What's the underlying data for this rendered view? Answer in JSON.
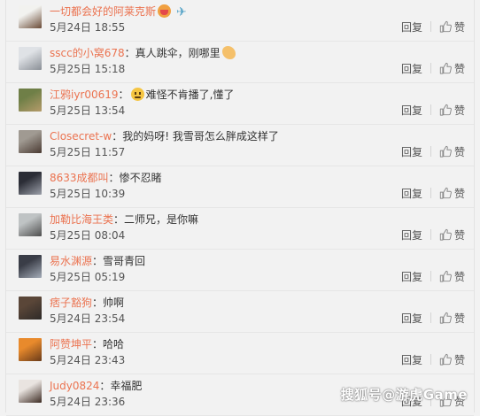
{
  "comments": [
    {
      "user": "一切都会好的阿莱克斯",
      "separator": "",
      "text": "",
      "emoji": [
        "red",
        "plane"
      ],
      "time": "5月24日 18:55",
      "reply": "回复",
      "like": "赞",
      "avatar_colors": [
        "#f2f2ef",
        "#6a4a35"
      ]
    },
    {
      "user": "sscc的小窝678",
      "separator": "：",
      "text": "真人跳伞，刚哪里",
      "emoji": [
        "arm"
      ],
      "time": "5月25日 15:18",
      "reply": "回复",
      "like": "赞",
      "avatar_colors": [
        "#dfe2e6",
        "#8a8f96"
      ]
    },
    {
      "user": "江鸦iyr00619",
      "separator": "：",
      "text": "难怪不肯播了,懂了",
      "emoji_before": true,
      "emoji": [
        "face"
      ],
      "time": "5月25日 13:54",
      "reply": "回复",
      "like": "赞",
      "avatar_colors": [
        "#6f7f47",
        "#b59b6a"
      ]
    },
    {
      "user": "Closecret-w",
      "separator": "：",
      "text": "我的妈呀! 我雪哥怎么胖成这样了",
      "emoji": [],
      "time": "5月25日 11:57",
      "reply": "回复",
      "like": "赞",
      "avatar_colors": [
        "#a09a92",
        "#4a3a32"
      ]
    },
    {
      "user": "8633成都叫",
      "separator": "：",
      "text": "惨不忍睹",
      "emoji": [],
      "time": "5月25日 10:39",
      "reply": "回复",
      "like": "赞",
      "avatar_colors": [
        "#2b2d36",
        "#9ca0aa"
      ]
    },
    {
      "user": "加勒比海王类",
      "separator": "：",
      "text": "二师兄，是你嘛",
      "emoji": [],
      "time": "5月25日 08:04",
      "reply": "回复",
      "like": "赞",
      "avatar_colors": [
        "#bfc3c4",
        "#4e4e4e"
      ]
    },
    {
      "user": "易水渊源",
      "separator": "：",
      "text": "雪哥青回",
      "emoji": [],
      "time": "5月25日 05:19",
      "reply": "回复",
      "like": "赞",
      "avatar_colors": [
        "#3a3d47",
        "#a4acb8"
      ]
    },
    {
      "user": "痞子豁狗",
      "separator": "：",
      "text": "帅啊",
      "emoji": [],
      "time": "5月24日 23:54",
      "reply": "回复",
      "like": "赞",
      "avatar_colors": [
        "#5a4638",
        "#2e2a28"
      ]
    },
    {
      "user": "阿赞坤平",
      "separator": "：",
      "text": "哈哈",
      "emoji": [],
      "time": "5月24日 23:43",
      "reply": "回复",
      "like": "赞",
      "avatar_colors": [
        "#e88a2c",
        "#6a3b1a"
      ]
    },
    {
      "user": "Judy0824",
      "separator": "：",
      "text": "幸福肥",
      "emoji": [],
      "time": "5月24日 23:36",
      "reply": "回复",
      "like": "赞",
      "avatar_colors": [
        "#e9e4e0",
        "#3c2a22"
      ]
    }
  ],
  "watermark": "搜狐号@游虎Game",
  "colors": {
    "username": "#eb7350",
    "background": "#f2f2f2"
  }
}
